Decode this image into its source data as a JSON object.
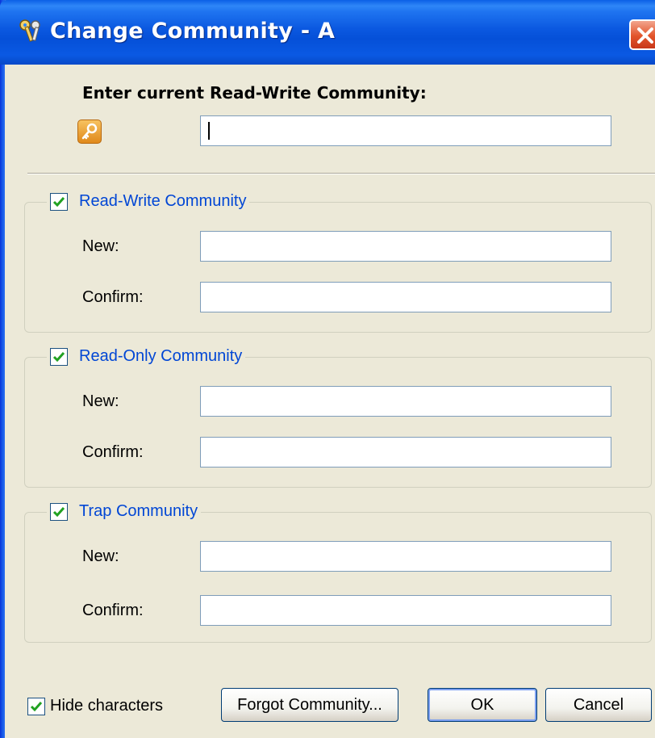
{
  "window": {
    "title": "Change Community - A"
  },
  "prompt": {
    "label": "Enter current Read-Write Community:",
    "value": ""
  },
  "groups": [
    {
      "title": "Read-Write Community",
      "checked": true,
      "new_label": "New:",
      "confirm_label": "Confirm:",
      "new_value": "",
      "confirm_value": ""
    },
    {
      "title": "Read-Only Community",
      "checked": true,
      "new_label": "New:",
      "confirm_label": "Confirm:",
      "new_value": "",
      "confirm_value": ""
    },
    {
      "title": "Trap Community",
      "checked": true,
      "new_label": "New:",
      "confirm_label": "Confirm:",
      "new_value": "",
      "confirm_value": ""
    }
  ],
  "footer": {
    "hide_characters_label": "Hide characters",
    "hide_characters_checked": true,
    "forgot_button": "Forgot Community...",
    "ok_button": "OK",
    "cancel_button": "Cancel"
  },
  "colors": {
    "titlebar": "#0550d8",
    "dialog_bg": "#ece9d8",
    "group_title": "#0046d5",
    "checkmark": "#21a121",
    "close_button": "#e2542a"
  },
  "icons": {
    "title": "keys-icon",
    "close": "close-icon",
    "prompt": "key-icon",
    "checkbox": "checkmark-icon"
  }
}
